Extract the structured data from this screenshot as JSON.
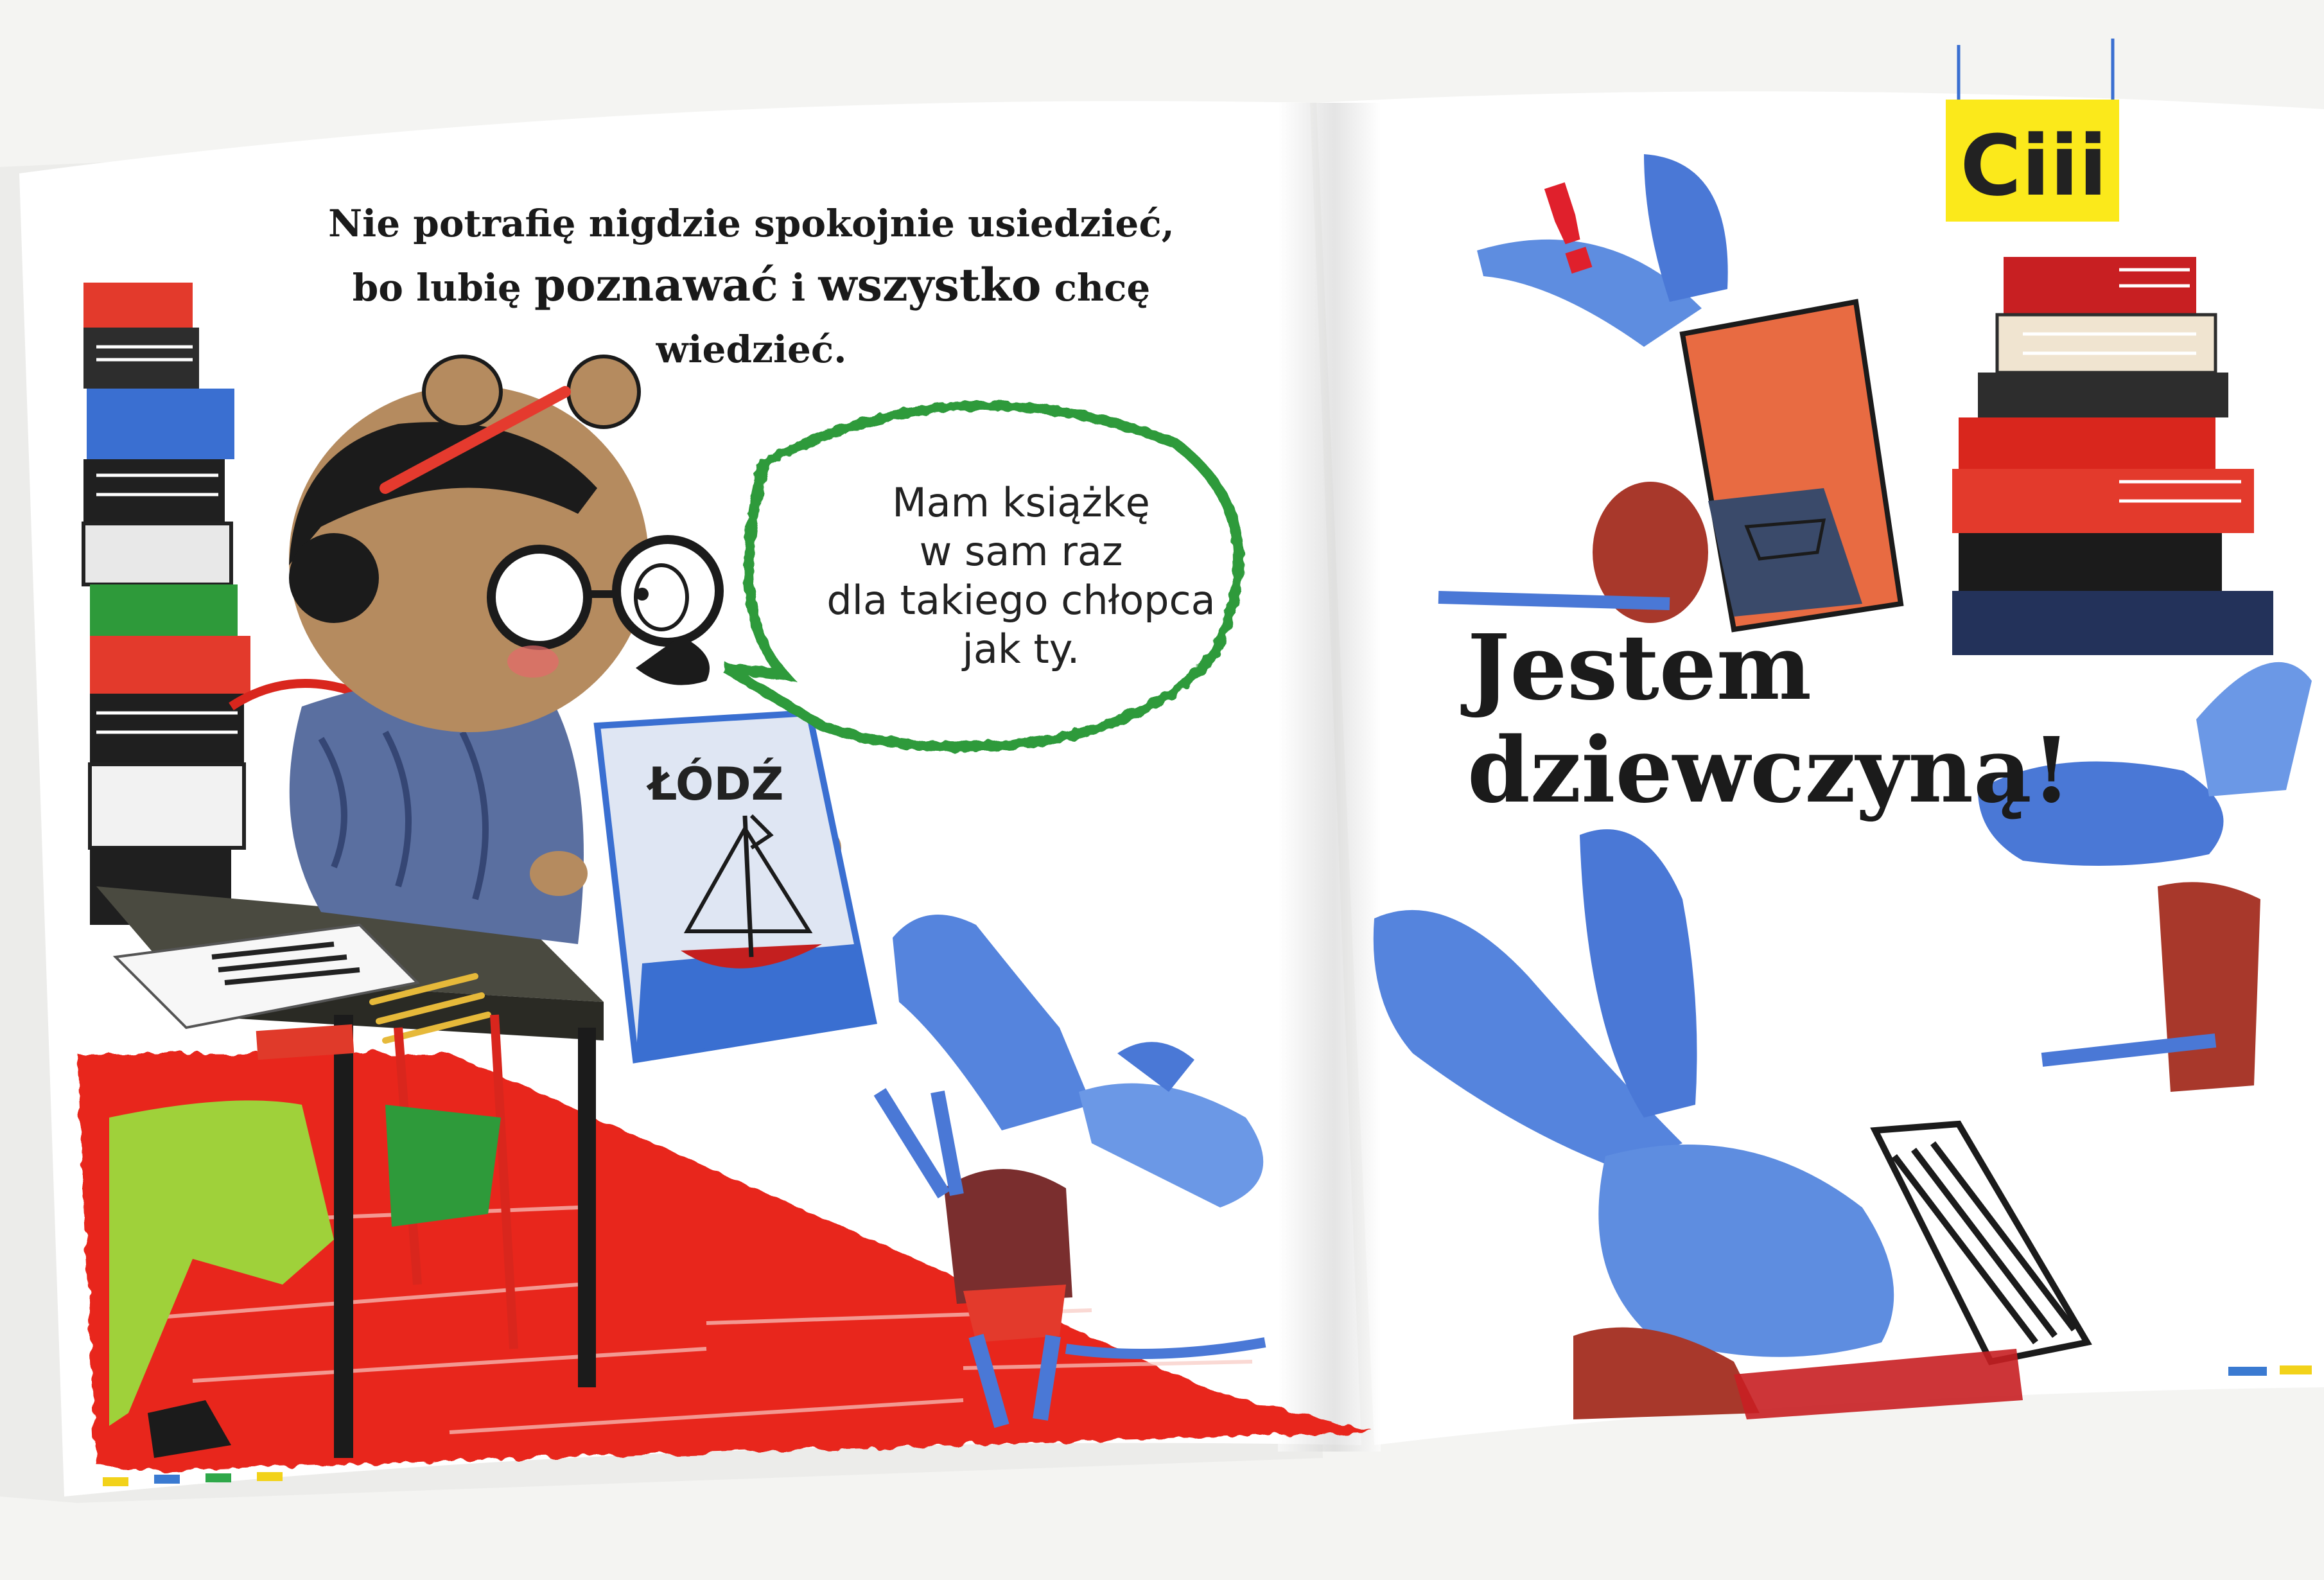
{
  "left_page": {
    "caption_line1": "Nie potrafię nigdzie spokojnie usiedzieć,",
    "caption_line2_a": "bo lubię",
    "caption_line2_b": "poznawać",
    "caption_line2_c": "i",
    "caption_line2_d": "wszystko",
    "caption_line2_e": "chcę wiedzieć.",
    "speech_bubble": [
      "Mam książkę",
      "w sam raz",
      "dla takiego chłopca",
      "jak ty."
    ],
    "book_cover_title": "ŁÓDŹ"
  },
  "right_page": {
    "sign_text": "Ciii",
    "exclamation": "!",
    "shout_line1": "Jestem",
    "shout_line2": "dziewczyną!"
  },
  "colors": {
    "page": "#ffffff",
    "floor_red": "#e8261b",
    "speech_bubble_outline": "#2e9a3a",
    "sign_yellow": "#fbe91b",
    "aardvark_blue": "#4d7fd9",
    "book_spines": "#c81f22"
  },
  "icons": [
    "aardvark-character",
    "bear-librarian",
    "book-stack",
    "boat-book-cover",
    "hanging-sign"
  ]
}
